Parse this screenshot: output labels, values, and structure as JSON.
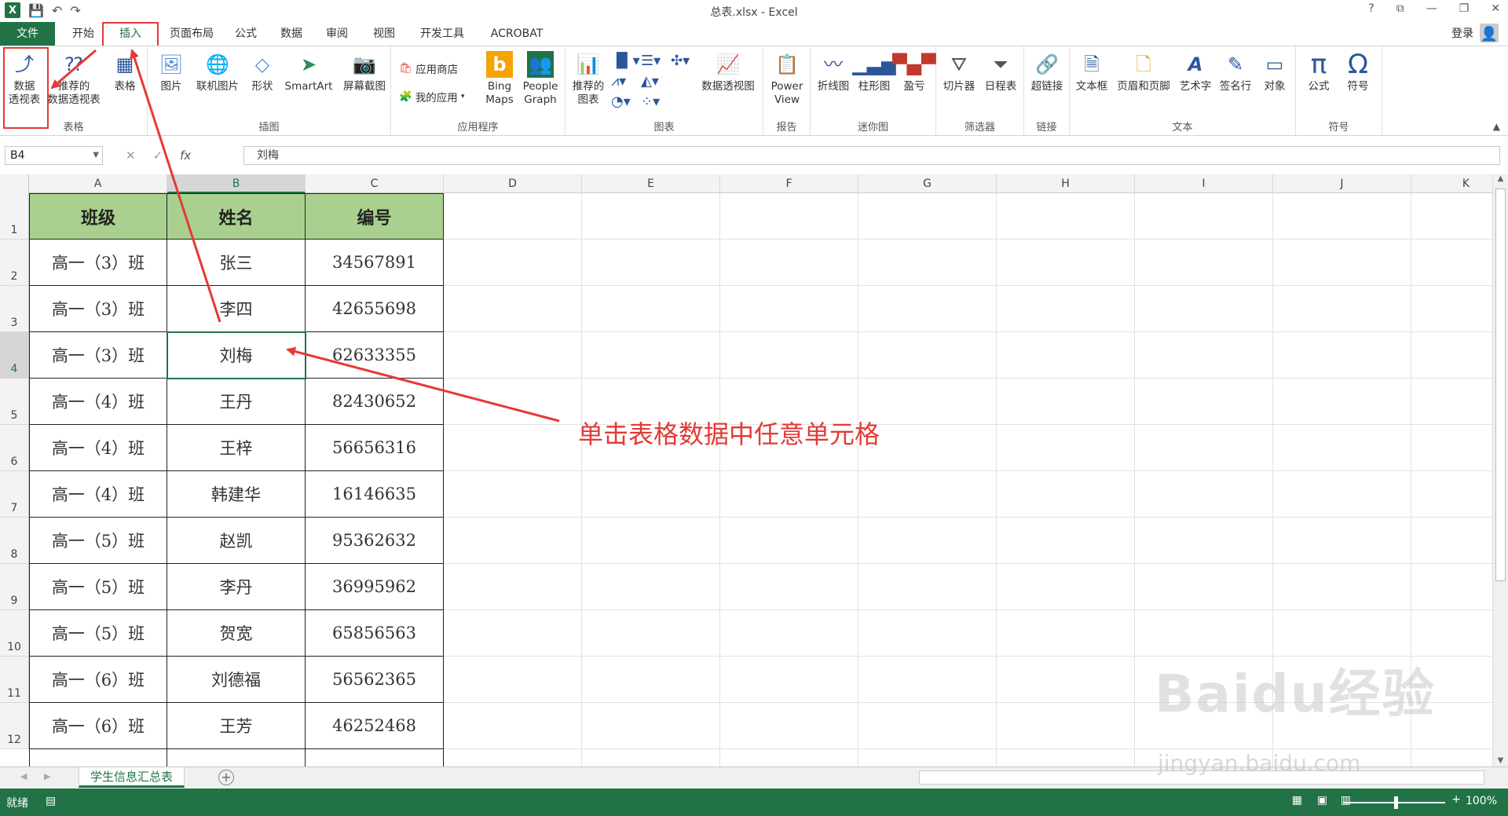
{
  "window": {
    "title": "总表.xlsx - Excel",
    "help": "?",
    "ribbon_display": "⧉",
    "minimize": "—",
    "restore": "❐",
    "close": "✕"
  },
  "qat": {
    "logo": "X",
    "save_icon": "save-icon",
    "undo_icon": "undo-icon",
    "redo_icon": "redo-icon"
  },
  "tabs": {
    "file": "文件",
    "home": "开始",
    "insert": "插入",
    "layout": "页面布局",
    "formulas": "公式",
    "data": "数据",
    "review": "审阅",
    "view": "视图",
    "developer": "开发工具",
    "acrobat": "ACROBAT"
  },
  "account": {
    "login": "登录"
  },
  "ribbon": {
    "pivot": "数据\n透视表",
    "rec_pivot": "推荐的\n数据透视表",
    "table": "表格",
    "grp_tables": "表格",
    "picture": "图片",
    "online_picture": "联机图片",
    "shapes": "形状",
    "smartart": "SmartArt",
    "screenshot": "屏幕截图",
    "grp_illus": "插图",
    "store": "应用商店",
    "myapps": "我的应用",
    "bing": "Bing\nMaps",
    "people": "People\nGraph",
    "grp_apps": "应用程序",
    "rec_charts": "推荐的\n图表",
    "pivot_chart": "数据透视图",
    "grp_charts": "图表",
    "power_view": "Power\nView",
    "grp_reports": "报告",
    "line": "折线图",
    "column": "柱形图",
    "winloss": "盈亏",
    "grp_spark": "迷你图",
    "slicer": "切片器",
    "timeline": "日程表",
    "grp_filter": "筛选器",
    "hyperlink": "超链接",
    "grp_links": "链接",
    "textbox": "文本框",
    "headerfooter": "页眉和页脚",
    "wordart": "艺术字",
    "signature": "签名行",
    "object": "对象",
    "grp_text": "文本",
    "equation": "公式",
    "symbol": "符号",
    "grp_symbols": "符号"
  },
  "formula_bar": {
    "name_box": "B4",
    "fx": "fx",
    "cancel": "✕",
    "enter": "✓",
    "value": "刘梅"
  },
  "columns": [
    "A",
    "B",
    "C",
    "D",
    "E",
    "F",
    "G",
    "H",
    "I",
    "J",
    "K"
  ],
  "rows": [
    "1",
    "2",
    "3",
    "4",
    "5",
    "6",
    "7",
    "8",
    "9",
    "10",
    "11",
    "12"
  ],
  "table": {
    "headers": [
      "班级",
      "姓名",
      "编号"
    ],
    "data": [
      [
        "高一（3）班",
        "张三",
        "34567891"
      ],
      [
        "高一（3）班",
        "李四",
        "42655698"
      ],
      [
        "高一（3）班",
        "刘梅",
        "62633355"
      ],
      [
        "高一（4）班",
        "王丹",
        "82430652"
      ],
      [
        "高一（4）班",
        "王梓",
        "56656316"
      ],
      [
        "高一（4）班",
        "韩建华",
        "16146635"
      ],
      [
        "高一（5）班",
        "赵凯",
        "95362632"
      ],
      [
        "高一（5）班",
        "李丹",
        "36995962"
      ],
      [
        "高一（5）班",
        "贺宽",
        "65856563"
      ],
      [
        "高一（6）班",
        "刘德福",
        "56562365"
      ],
      [
        "高一（6）班",
        "王芳",
        "46252468"
      ]
    ]
  },
  "sheet": {
    "tab": "学生信息汇总表",
    "add": "+"
  },
  "status": {
    "text": "就绪",
    "zoom": "100%"
  },
  "annotation": "单击表格数据中任意单元格",
  "watermark": {
    "main": "Baidu经验",
    "url": "jingyan.baidu.com"
  },
  "colors": {
    "excel_green": "#217346",
    "header_fill": "#a9d08e",
    "annotation_red": "#e53935"
  }
}
